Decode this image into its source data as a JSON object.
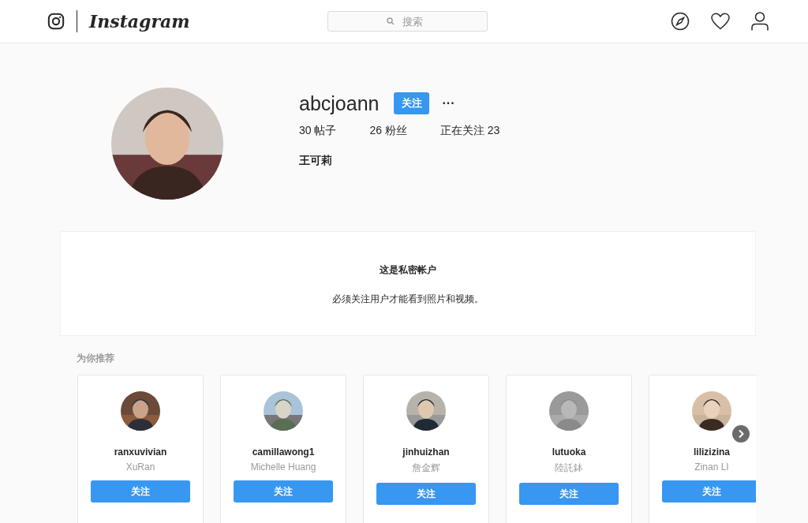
{
  "header": {
    "logo_text": "Instagram",
    "search": {
      "placeholder": "搜索"
    }
  },
  "profile": {
    "username": "abcjoann",
    "follow_button": "关注",
    "more_button": "···",
    "stats": [
      "30 帖子",
      "26 粉丝",
      "正在关注 23"
    ],
    "full_name": "王可莉"
  },
  "private_notice": {
    "title": "这是私密帐户",
    "message": "必须关注用户才能看到照片和视频。"
  },
  "suggestions": {
    "title": "为你推荐",
    "cards": [
      {
        "username": "ranxuvivian",
        "name": "XuRan",
        "button": "关注"
      },
      {
        "username": "camillawong1",
        "name": "Michelle Huang",
        "button": "关注"
      },
      {
        "username": "jinhuizhan",
        "name": "詹金辉",
        "button": "关注"
      },
      {
        "username": "lutuoka",
        "name": "陸託鉢",
        "button": "关注"
      },
      {
        "username": "lilizizina",
        "name": "Zinan LI",
        "button": "关注"
      }
    ]
  }
}
